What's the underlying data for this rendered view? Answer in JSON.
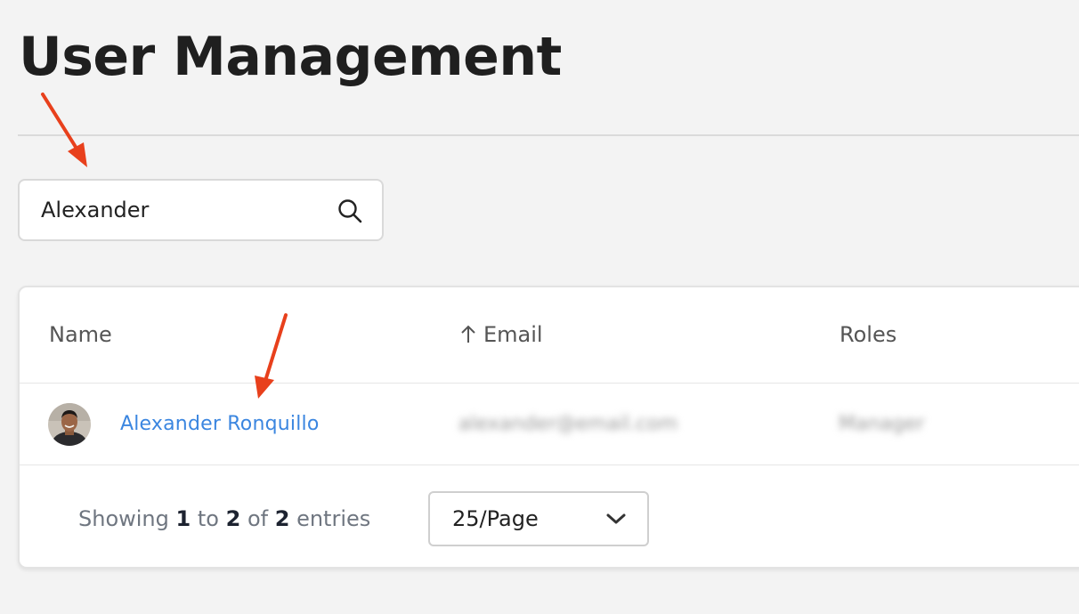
{
  "page": {
    "title": "User Management"
  },
  "search": {
    "value": "Alexander",
    "icon": "search-icon"
  },
  "table": {
    "columns": [
      {
        "label": "Name",
        "sort": ""
      },
      {
        "label": "Email",
        "sort": "ascending"
      },
      {
        "label": "Roles",
        "sort": ""
      }
    ],
    "rows": [
      {
        "name": "Alexander Ronquillo",
        "email": "alexander@email.com",
        "role": "Manager",
        "avatar": "avatar-photo"
      }
    ]
  },
  "footer": {
    "prefix": "Showing",
    "from": "1",
    "to_word": "to",
    "to": "2",
    "of_word": "of",
    "total": "2",
    "suffix": "entries"
  },
  "pagination": {
    "page_size": "25/Page",
    "icon": "chevron-down-icon"
  },
  "annotations": {
    "arrow_color": "#e8401c"
  },
  "colors": {
    "link": "#3b86e0",
    "background": "#f3f3f3"
  }
}
